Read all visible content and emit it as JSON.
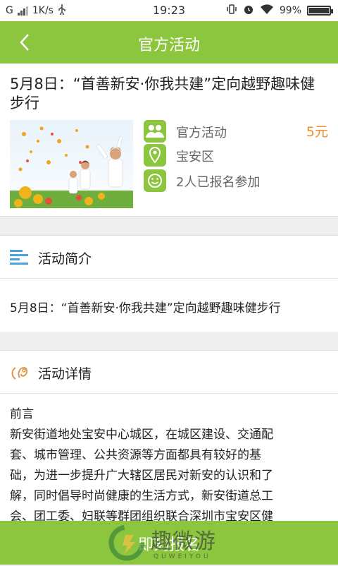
{
  "status_bar": {
    "network": "G",
    "speed": "1K/s",
    "time": "19:23",
    "battery": "99%",
    "battery_level": 0.99
  },
  "header": {
    "title": "官方活动"
  },
  "event": {
    "title": "5月8日：“首善新安·你我共建”定向越野趣味健步行",
    "category": "官方活动",
    "price": "5元",
    "location": "宝安区",
    "participants": "2人已报名参加"
  },
  "intro": {
    "heading": "活动简介",
    "text": "5月8日：“首善新安·你我共建”定向越野趣味健步行"
  },
  "details": {
    "heading": "活动详情",
    "lines": [
      "前言",
      "新安街道地处宝安中心城区，在城区建设、交通配",
      "套、城市管理、公共资源等方面都具有较好的基",
      "础，为进一步提升广大辖区居民对新安的认识和了",
      "解，同时倡导时尚健康的生活方式，新安街道总工",
      "会、团工委、妇联等群团组织联合深圳市宝安区健"
    ]
  },
  "bottom": {
    "cta": "即刻报名"
  },
  "watermark": {
    "text": "趣微游",
    "sub": "QUWEIYOU"
  },
  "colors": {
    "accent": "#8cc63f",
    "price": "#f08c2a",
    "intro_icon": "#4aa3df",
    "detail_icon": "#e08a3a"
  }
}
